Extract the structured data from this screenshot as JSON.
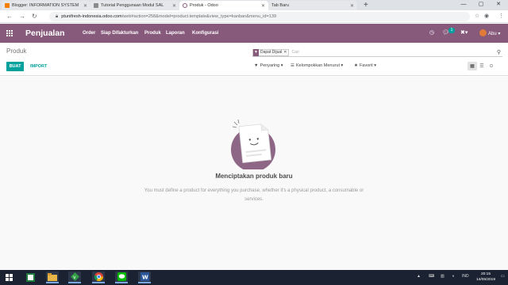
{
  "browser": {
    "tabs": [
      {
        "label": "Blogger: INFORMATION SYSTEM",
        "favicon": "blogger-icon",
        "color": "#f57d00",
        "active": false
      },
      {
        "label": "Tutorial Penggunaan Modul SAL",
        "favicon": "graph-icon",
        "color": "#666666",
        "active": false
      },
      {
        "label": "Produk - Odoo",
        "favicon": "odoo-icon",
        "color": "#875a7b",
        "active": true
      },
      {
        "label": "Tab Baru",
        "favicon": "",
        "color": "#dee1e6",
        "active": false
      }
    ],
    "url_host": "ptunifresh-indonesia.odoo.com",
    "url_path": "/web#action=258&model=product.template&view_type=kanban&menu_id=139"
  },
  "navbar": {
    "app_title": "Penjualan",
    "menu": [
      "Order",
      "Siap Difakturkan",
      "Produk",
      "Laporan",
      "Konfigurasi"
    ],
    "chat_count": "1",
    "user": "Abu",
    "color": "#875a7b"
  },
  "control_panel": {
    "breadcrumb": "Produk",
    "facet_label": "Dapat Dijual",
    "search_placeholder": "Cari",
    "create_label": "BUAT",
    "import_label": "IMPORT",
    "filters_label": "Penyaring",
    "groupby_label": "Kelompokkan Menurut",
    "favorites_label": "Favorit"
  },
  "empty_state": {
    "title": "Menciptakan produk baru",
    "text": "You must define a product for everything you purchase, whether it's a physical product, a consumable or services."
  },
  "taskbar": {
    "apps": [
      "windows-start-icon",
      "word-icon",
      "file-explorer-icon",
      "gvim-icon",
      "chrome-icon",
      "line-icon",
      "word-doc-icon"
    ],
    "lang": "IND",
    "time": "20:15",
    "date": "14/05/2019"
  }
}
